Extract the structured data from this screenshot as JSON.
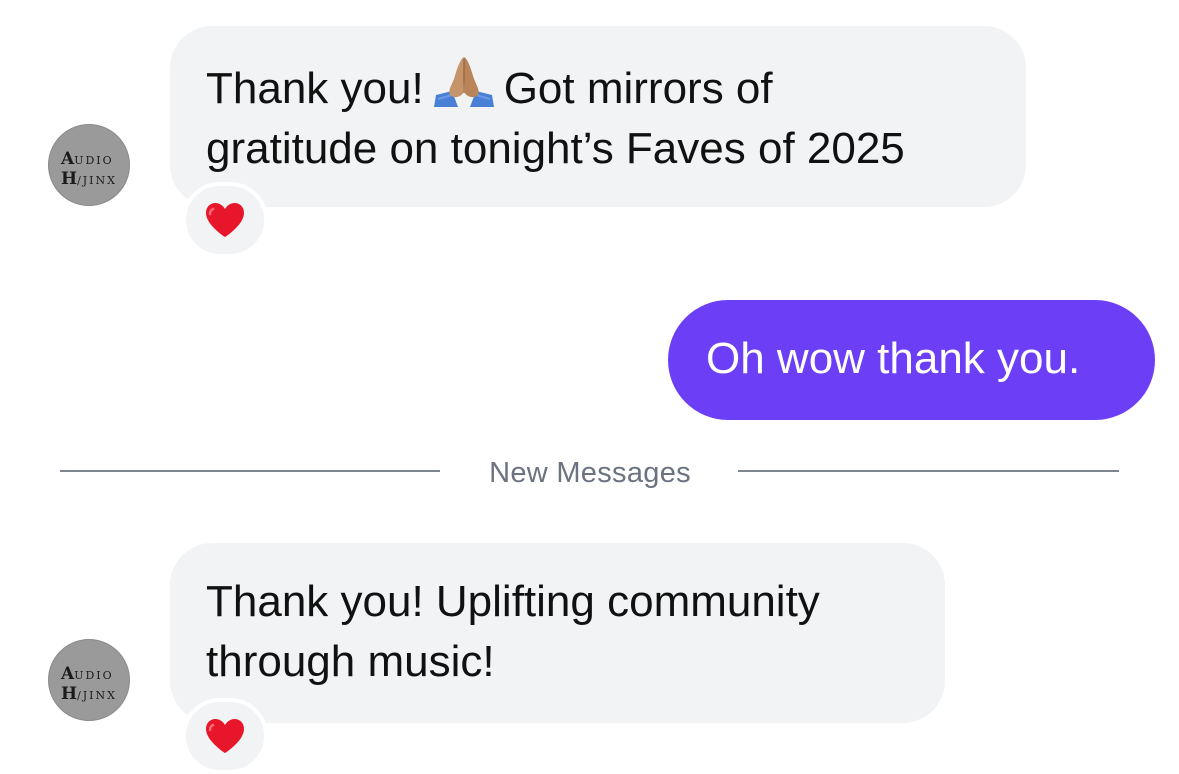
{
  "conversation": {
    "messages": [
      {
        "direction": "incoming",
        "sender_avatar_text": {
          "line1_initial": "A",
          "line1": "UDIO",
          "line2_initial": "H",
          "line2": "/JINX"
        },
        "text_line1_before_emoji": "Thank you!",
        "emoji": "folded-hands",
        "text_line1_after_emoji": "Got mirrors of",
        "text_line2": "gratitude on tonight’s Faves of 2025",
        "reaction": "heart"
      },
      {
        "direction": "outgoing",
        "text": "Oh wow thank you."
      },
      {
        "direction": "incoming",
        "sender_avatar_text": {
          "line1_initial": "A",
          "line1": "UDIO",
          "line2_initial": "H",
          "line2": "/JINX"
        },
        "text_line1": "Thank you! Uplifting community",
        "text_line2": "through music!",
        "reaction": "heart"
      }
    ],
    "divider": {
      "label": "New Messages"
    }
  },
  "colors": {
    "incoming_bubble": "#f2f3f5",
    "outgoing_bubble": "#6c3ff7",
    "outgoing_text": "#ffffff",
    "divider": "#7d8590",
    "reaction_heart": "#e8162b"
  }
}
